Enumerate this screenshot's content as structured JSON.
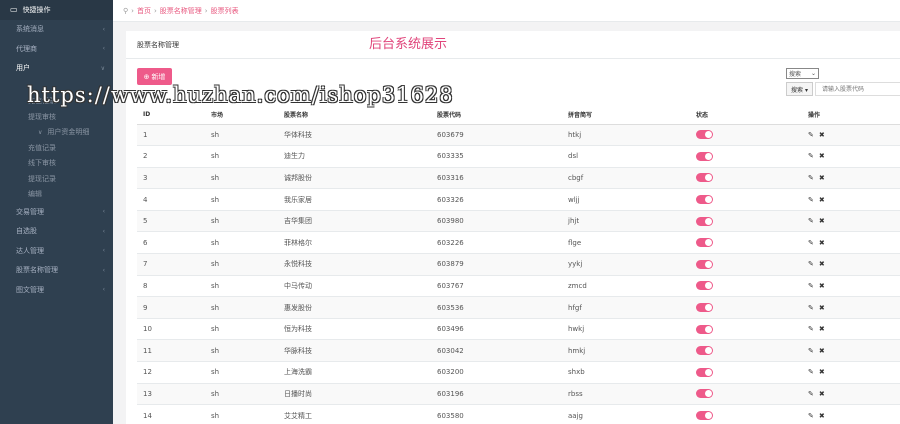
{
  "sidebar": {
    "head_label": "快捷操作",
    "items": [
      {
        "label": "系统消息",
        "type": "item"
      },
      {
        "label": "代理商",
        "type": "item"
      },
      {
        "label": "用户",
        "type": "item",
        "active": true
      },
      {
        "label": "",
        "type": "gap"
      },
      {
        "label": "充值记录",
        "type": "sub"
      },
      {
        "label": "提现审核",
        "type": "sub"
      },
      {
        "label": "用户资金明细",
        "type": "sub2"
      },
      {
        "label": "充值记录",
        "type": "sub"
      },
      {
        "label": "线下审核",
        "type": "sub"
      },
      {
        "label": "提现记录",
        "type": "sub"
      },
      {
        "label": "编辑",
        "type": "sub"
      },
      {
        "label": "交易管理",
        "type": "item"
      },
      {
        "label": "自选股",
        "type": "item"
      },
      {
        "label": "达人管理",
        "type": "item"
      },
      {
        "label": "股票名称管理",
        "type": "item"
      },
      {
        "label": "图文管理",
        "type": "item"
      }
    ]
  },
  "breadcrumb": [
    "首页",
    "股票名称管理",
    "股票列表"
  ],
  "panel": {
    "title": "股票名称管理",
    "overlay_title": "后台系统展示",
    "add_label": "新增"
  },
  "search": {
    "select_value": "搜索",
    "button_label": "搜索 ▾",
    "placeholder": "请输入股票代码"
  },
  "watermark": "https://www.huzhan.com/ishop31628",
  "table": {
    "headers": [
      "ID",
      "市场",
      "股票名称",
      "股票代码",
      "拼音简写",
      "状态",
      "操作"
    ],
    "rows": [
      [
        "1",
        "sh",
        "华体科技",
        "603679",
        "htkj"
      ],
      [
        "2",
        "sh",
        "迪生力",
        "603335",
        "dsl"
      ],
      [
        "3",
        "sh",
        "诚邦股份",
        "603316",
        "cbgf"
      ],
      [
        "4",
        "sh",
        "我乐家居",
        "603326",
        "wljj"
      ],
      [
        "5",
        "sh",
        "吉华集团",
        "603980",
        "jhjt"
      ],
      [
        "6",
        "sh",
        "菲林格尔",
        "603226",
        "flge"
      ],
      [
        "7",
        "sh",
        "永悦科技",
        "603879",
        "yykj"
      ],
      [
        "8",
        "sh",
        "中马传动",
        "603767",
        "zmcd"
      ],
      [
        "9",
        "sh",
        "惠发股份",
        "603536",
        "hfgf"
      ],
      [
        "10",
        "sh",
        "恒为科技",
        "603496",
        "hwkj"
      ],
      [
        "11",
        "sh",
        "华脉科技",
        "603042",
        "hmkj"
      ],
      [
        "12",
        "sh",
        "上海洗霸",
        "603200",
        "shxb"
      ],
      [
        "13",
        "sh",
        "日播时尚",
        "603196",
        "rbss"
      ],
      [
        "14",
        "sh",
        "艾艾精工",
        "603580",
        "aajg"
      ]
    ],
    "status_on": true
  },
  "colors": {
    "accent": "#ee5a8a",
    "sidebar_bg": "#2f4050"
  }
}
